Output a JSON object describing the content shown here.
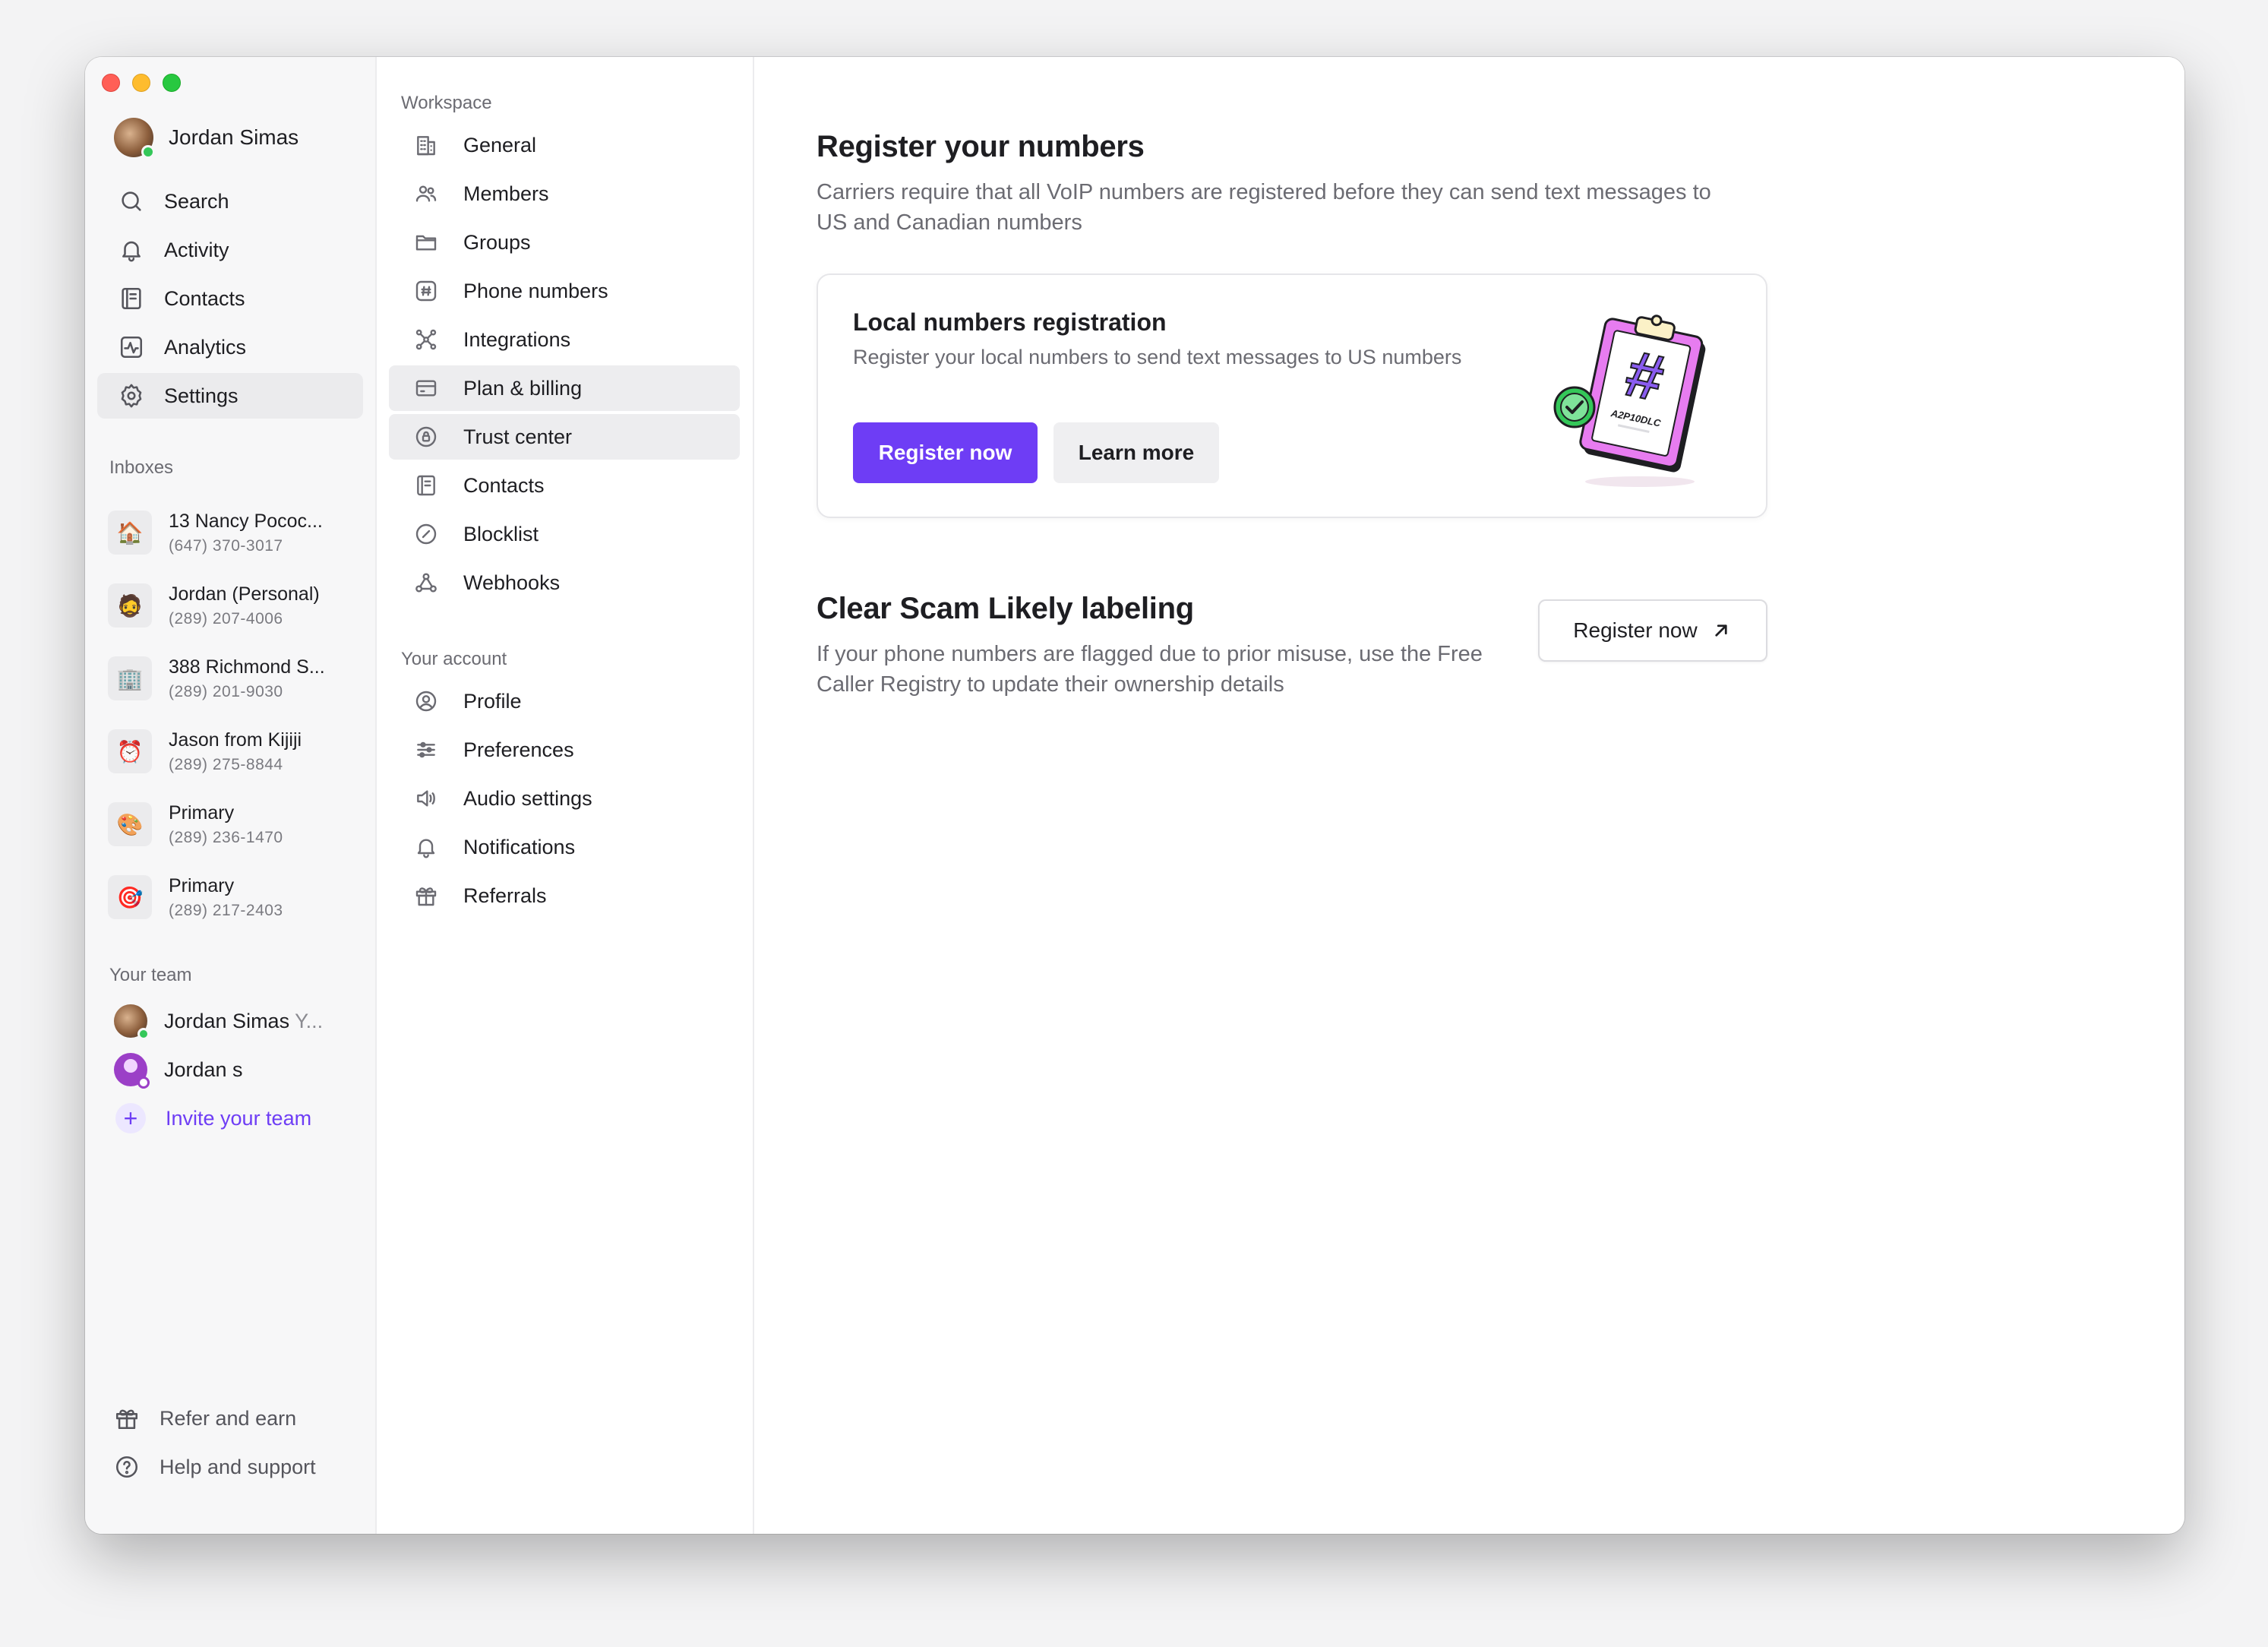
{
  "user": {
    "name": "Jordan Simas"
  },
  "sidebar": {
    "nav": [
      {
        "label": "Search",
        "icon": "search-icon"
      },
      {
        "label": "Activity",
        "icon": "bell-icon"
      },
      {
        "label": "Contacts",
        "icon": "contacts-icon"
      },
      {
        "label": "Analytics",
        "icon": "analytics-icon"
      },
      {
        "label": "Settings",
        "icon": "gear-icon",
        "active": true
      }
    ],
    "inboxes_label": "Inboxes",
    "inboxes": [
      {
        "name": "13 Nancy Pococ...",
        "phone": "(647) 370-3017",
        "emoji": "🏠"
      },
      {
        "name": "Jordan (Personal)",
        "phone": "(289) 207-4006",
        "emoji": "🧔"
      },
      {
        "name": "388 Richmond S...",
        "phone": "(289) 201-9030",
        "emoji": "🏢"
      },
      {
        "name": "Jason from Kijiji",
        "phone": "(289) 275-8844",
        "emoji": "⏰"
      },
      {
        "name": "Primary",
        "phone": "(289) 236-1470",
        "emoji": "🎨"
      },
      {
        "name": "Primary",
        "phone": "(289) 217-2403",
        "emoji": "🎯"
      }
    ],
    "team_label": "Your team",
    "team": [
      {
        "name": "Jordan Simas",
        "suffix": " Y..."
      },
      {
        "name": "Jordan s"
      }
    ],
    "invite_label": "Invite your team",
    "footer": [
      {
        "label": "Refer and earn",
        "icon": "gift-icon"
      },
      {
        "label": "Help and support",
        "icon": "help-icon"
      }
    ]
  },
  "settings": {
    "workspace_label": "Workspace",
    "workspace": [
      {
        "label": "General",
        "icon": "building-icon"
      },
      {
        "label": "Members",
        "icon": "members-icon"
      },
      {
        "label": "Groups",
        "icon": "folder-icon"
      },
      {
        "label": "Phone numbers",
        "icon": "hash-icon"
      },
      {
        "label": "Integrations",
        "icon": "integrations-icon"
      },
      {
        "label": "Plan & billing",
        "icon": "card-icon",
        "highlighted": true
      },
      {
        "label": "Trust center",
        "icon": "shield-icon",
        "highlighted": true
      },
      {
        "label": "Contacts",
        "icon": "contacts-icon"
      },
      {
        "label": "Blocklist",
        "icon": "block-icon"
      },
      {
        "label": "Webhooks",
        "icon": "webhook-icon"
      }
    ],
    "account_label": "Your account",
    "account": [
      {
        "label": "Profile",
        "icon": "profile-icon"
      },
      {
        "label": "Preferences",
        "icon": "sliders-icon"
      },
      {
        "label": "Audio settings",
        "icon": "speaker-icon"
      },
      {
        "label": "Notifications",
        "icon": "bell-icon"
      },
      {
        "label": "Referrals",
        "icon": "gift-icon"
      }
    ]
  },
  "main": {
    "title": "Register your numbers",
    "subtitle": "Carriers require that all VoIP numbers are registered before they can send text messages to US and Canadian numbers",
    "card": {
      "title": "Local numbers registration",
      "description": "Register your local numbers to send text messages to US numbers",
      "primary_button": "Register now",
      "secondary_button": "Learn more",
      "illustration_label": "A2P10DLC"
    },
    "scam": {
      "title": "Clear Scam Likely labeling",
      "description": "If your phone numbers are flagged due to prior misuse, use the Free Caller Registry to update their ownership details",
      "button": "Register now"
    }
  },
  "colors": {
    "accent": "#6e3df5",
    "online": "#34c759"
  }
}
